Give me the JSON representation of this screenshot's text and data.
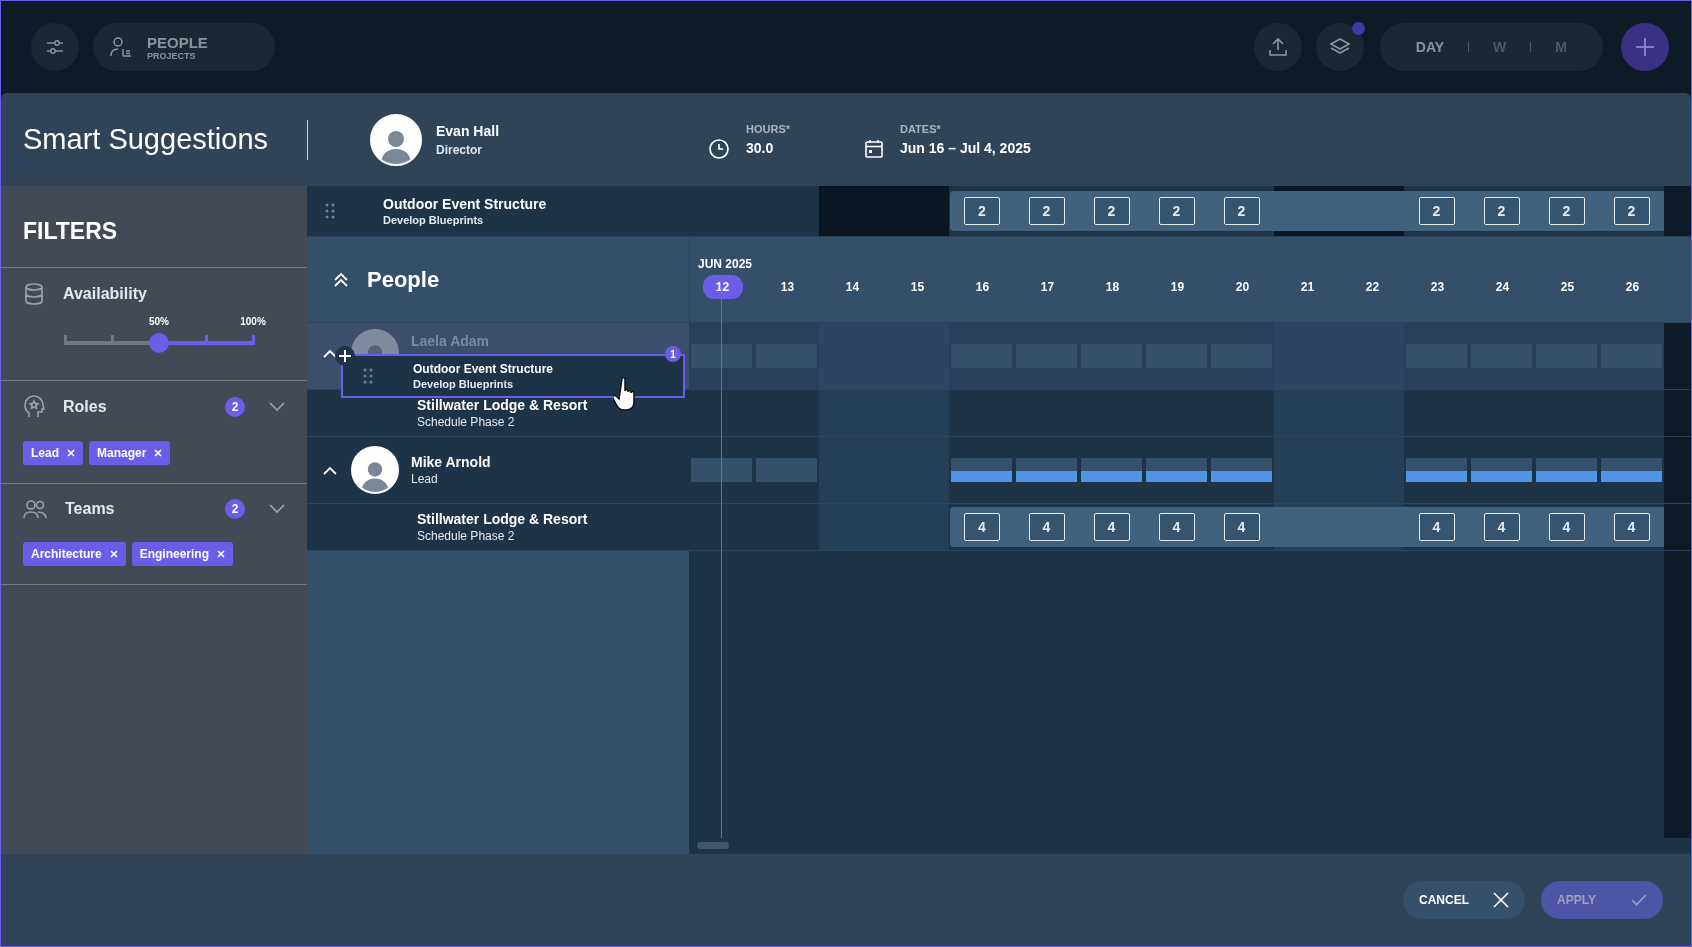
{
  "top_bar": {
    "mode_toggle": {
      "primary": "PEOPLE",
      "secondary": "PROJECTS"
    },
    "layers_notification": true,
    "views": [
      {
        "label": "DAY",
        "selected": true
      },
      {
        "label": "W",
        "selected": false
      },
      {
        "label": "M",
        "selected": false
      }
    ]
  },
  "header": {
    "title": "Smart Suggestions",
    "person": {
      "name": "Evan Hall",
      "role": "Director"
    },
    "hours": {
      "label": "HOURS*",
      "value": "30.0"
    },
    "dates": {
      "label": "DATES*",
      "value": "Jun 16 – Jul 4, 2025"
    }
  },
  "filters": {
    "title": "FILTERS",
    "availability": {
      "label": "Availability",
      "level": 0.5,
      "marks": [
        "50%",
        "100%"
      ]
    },
    "groups": [
      {
        "kind": "roles",
        "label": "Roles",
        "count": "2",
        "expanded": false,
        "chips": [
          "Lead",
          "Manager"
        ]
      },
      {
        "kind": "teams",
        "label": "Teams",
        "count": "2",
        "expanded": false,
        "chips": [
          "Architecture",
          "Engineering"
        ]
      }
    ]
  },
  "suggestion": {
    "project": "Outdoor Event Structure",
    "task": "Develop Blueprints",
    "cells": [
      {
        "kind": "none"
      },
      {
        "kind": "none"
      },
      {
        "kind": "none"
      },
      {
        "kind": "none"
      },
      {
        "kind": "hours",
        "text": "2"
      },
      {
        "kind": "hours",
        "text": "2"
      },
      {
        "kind": "hours",
        "text": "2"
      },
      {
        "kind": "hours",
        "text": "2"
      },
      {
        "kind": "hours",
        "text": "2"
      },
      {
        "kind": "gap"
      },
      {
        "kind": "gap"
      },
      {
        "kind": "hours",
        "text": "2"
      },
      {
        "kind": "hours",
        "text": "2"
      },
      {
        "kind": "hours",
        "text": "2"
      },
      {
        "kind": "hours",
        "text": "2"
      }
    ]
  },
  "timeline": {
    "section": "People",
    "expanded": true,
    "month": "JUN 2025",
    "days": [
      {
        "label": "12",
        "selected": true,
        "weekend": false
      },
      {
        "label": "13",
        "selected": false,
        "weekend": false
      },
      {
        "label": "14",
        "selected": false,
        "weekend": true
      },
      {
        "label": "15",
        "selected": false,
        "weekend": true
      },
      {
        "label": "16",
        "selected": false,
        "weekend": false
      },
      {
        "label": "17",
        "selected": false,
        "weekend": false
      },
      {
        "label": "18",
        "selected": false,
        "weekend": false
      },
      {
        "label": "19",
        "selected": false,
        "weekend": false
      },
      {
        "label": "20",
        "selected": false,
        "weekend": false
      },
      {
        "label": "21",
        "selected": false,
        "weekend": true
      },
      {
        "label": "22",
        "selected": false,
        "weekend": true
      },
      {
        "label": "23",
        "selected": false,
        "weekend": false
      },
      {
        "label": "24",
        "selected": false,
        "weekend": false
      },
      {
        "label": "25",
        "selected": false,
        "weekend": false
      },
      {
        "label": "26",
        "selected": false,
        "weekend": false
      }
    ]
  },
  "people": [
    {
      "name": "Laela Adam",
      "drop_target": true,
      "expanded": true,
      "load": [
        {
          "kind": "free"
        },
        {
          "kind": "free"
        },
        {
          "kind": "off"
        },
        {
          "kind": "off"
        },
        {
          "kind": "free"
        },
        {
          "kind": "free"
        },
        {
          "kind": "free"
        },
        {
          "kind": "free"
        },
        {
          "kind": "free"
        },
        {
          "kind": "off"
        },
        {
          "kind": "off"
        },
        {
          "kind": "free"
        },
        {
          "kind": "free"
        },
        {
          "kind": "free"
        },
        {
          "kind": "free"
        }
      ],
      "projects": [
        {
          "name": "Stillwater Lodge & Resort",
          "task": "Schedule Phase 2"
        }
      ]
    },
    {
      "name": "Mike Arnold",
      "role": "Lead",
      "drop_target": false,
      "expanded": true,
      "load": [
        {
          "kind": "free"
        },
        {
          "kind": "free"
        },
        {
          "kind": "off"
        },
        {
          "kind": "off"
        },
        {
          "kind": "booked"
        },
        {
          "kind": "booked"
        },
        {
          "kind": "booked"
        },
        {
          "kind": "booked"
        },
        {
          "kind": "booked"
        },
        {
          "kind": "off"
        },
        {
          "kind": "off"
        },
        {
          "kind": "booked"
        },
        {
          "kind": "booked"
        },
        {
          "kind": "booked"
        },
        {
          "kind": "booked"
        }
      ],
      "projects": [
        {
          "name": "Stillwater Lodge & Resort",
          "task": "Schedule Phase 2",
          "cells": [
            {
              "kind": "none"
            },
            {
              "kind": "none"
            },
            {
              "kind": "none"
            },
            {
              "kind": "none"
            },
            {
              "kind": "hours",
              "text": "4"
            },
            {
              "kind": "hours",
              "text": "4"
            },
            {
              "kind": "hours",
              "text": "4"
            },
            {
              "kind": "hours",
              "text": "4"
            },
            {
              "kind": "hours",
              "text": "4"
            },
            {
              "kind": "gap"
            },
            {
              "kind": "gap"
            },
            {
              "kind": "hours",
              "text": "4"
            },
            {
              "kind": "hours",
              "text": "4"
            },
            {
              "kind": "hours",
              "text": "4"
            },
            {
              "kind": "hours",
              "text": "4"
            }
          ]
        }
      ]
    }
  ],
  "drag_card": {
    "project": "Outdoor Event Structure",
    "task": "Develop Blueprints",
    "count": "1"
  },
  "footer": {
    "cancel": "CANCEL",
    "apply": {
      "label": "APPLY",
      "disabled": true
    }
  }
}
